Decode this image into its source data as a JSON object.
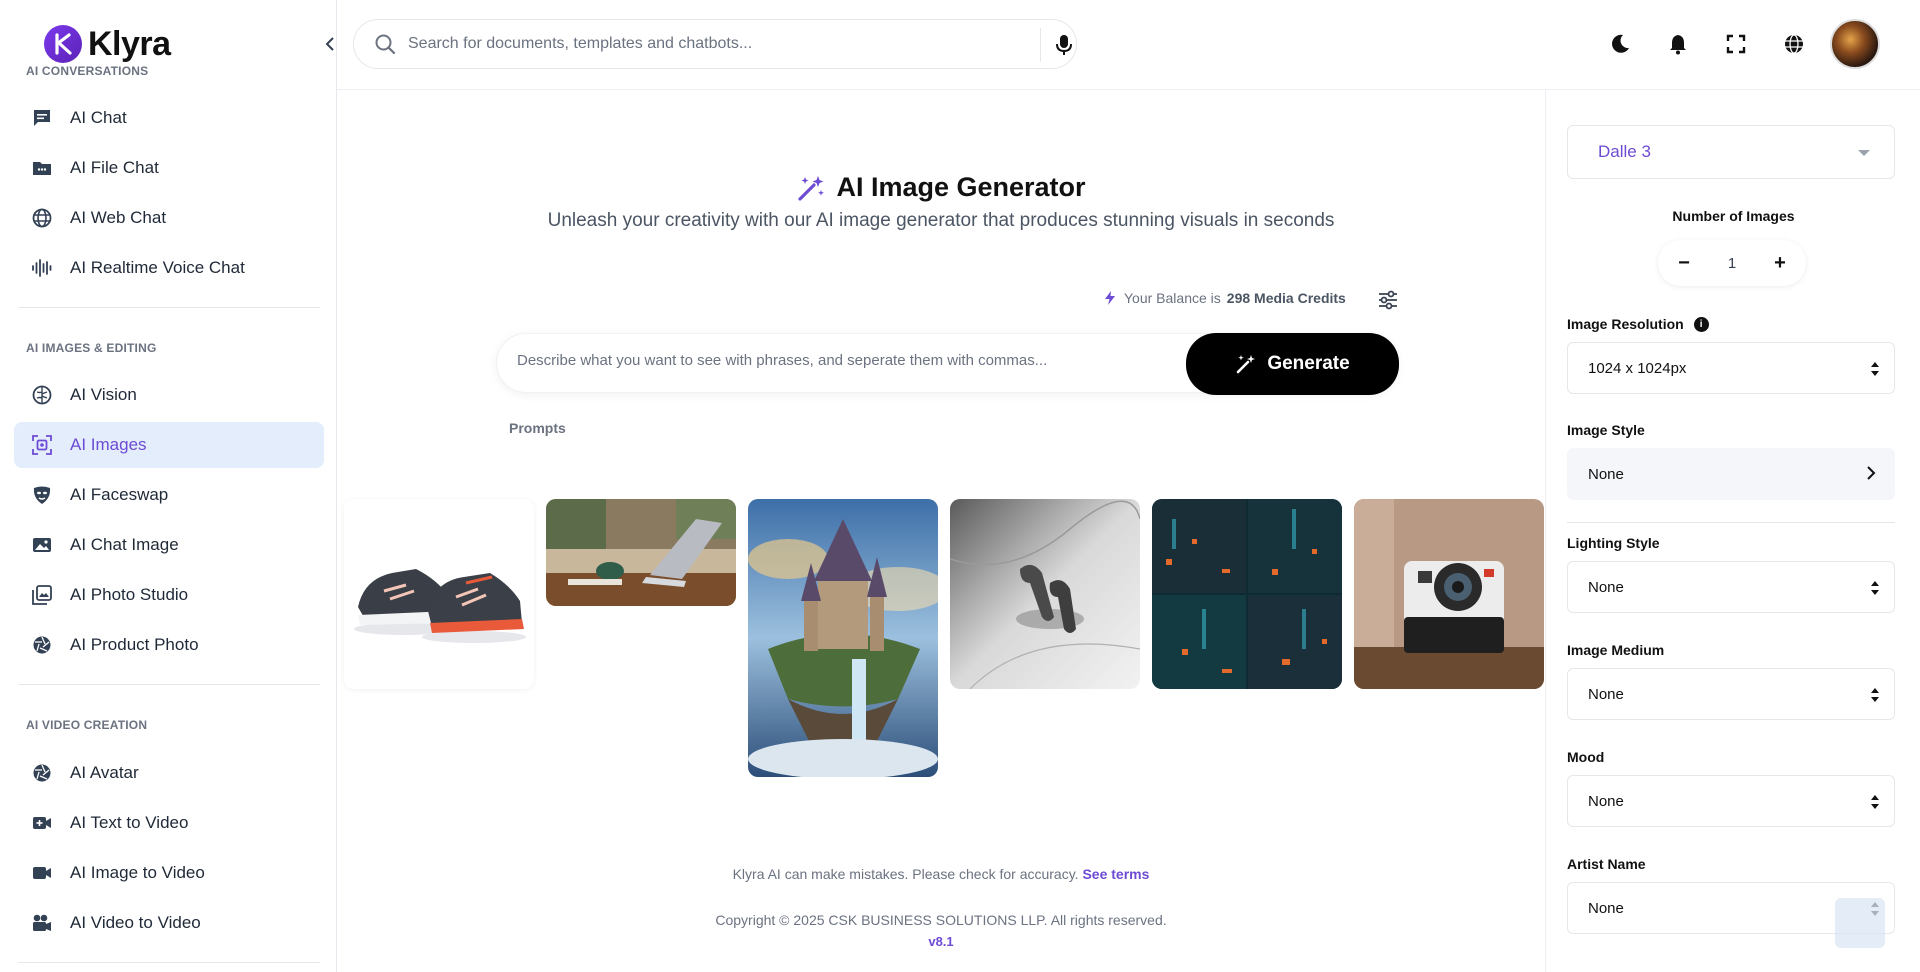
{
  "brand": {
    "name": "Klyra"
  },
  "sidebar": {
    "sections": [
      {
        "label": "AI CONVERSATIONS"
      },
      {
        "label": "AI IMAGES & EDITING"
      },
      {
        "label": "AI VIDEO CREATION"
      }
    ],
    "items": [
      {
        "label": "AI Chat",
        "icon": "chat-icon"
      },
      {
        "label": "AI File Chat",
        "icon": "folder-icon"
      },
      {
        "label": "AI Web Chat",
        "icon": "globe-icon"
      },
      {
        "label": "AI Realtime Voice Chat",
        "icon": "waveform-icon"
      },
      {
        "label": "AI Vision",
        "icon": "brain-icon"
      },
      {
        "label": "AI Images",
        "icon": "image-scan-icon",
        "active": true
      },
      {
        "label": "AI Faceswap",
        "icon": "mask-icon"
      },
      {
        "label": "AI Chat Image",
        "icon": "photo-icon"
      },
      {
        "label": "AI Photo Studio",
        "icon": "photo-library-icon"
      },
      {
        "label": "AI Product Photo",
        "icon": "aperture-icon"
      },
      {
        "label": "AI Avatar",
        "icon": "aperture-icon"
      },
      {
        "label": "AI Text to Video",
        "icon": "video-plus-icon"
      },
      {
        "label": "AI Image to Video",
        "icon": "video-camera-icon"
      },
      {
        "label": "AI Video to Video",
        "icon": "film-camera-icon"
      }
    ]
  },
  "topbar": {
    "search_placeholder": "Search for documents, templates and chatbots..."
  },
  "main": {
    "title": "AI Image Generator",
    "subtitle": "Unleash your creativity with our AI image generator that produces stunning visuals in seconds",
    "balance_prefix": "Your Balance is",
    "balance_value": "298 Media Credits",
    "prompt_placeholder": "Describe what you want to see with phrases, and seperate them with commas...",
    "generate_label": "Generate",
    "prompts_label": "Prompts",
    "examples": [
      {
        "name": "sneakers",
        "icon": "sneakers-image"
      },
      {
        "name": "laptop-desk",
        "icon": "laptop-image"
      },
      {
        "name": "floating-castle",
        "icon": "castle-image"
      },
      {
        "name": "earbuds",
        "icon": "earbuds-image"
      },
      {
        "name": "neon-city",
        "icon": "city-image"
      },
      {
        "name": "instant-camera",
        "icon": "camera-image"
      }
    ],
    "disclaimer": "Klyra AI can make mistakes. Please check for accuracy.",
    "terms_link": "See terms",
    "copyright": "Copyright © 2025 CSK BUSINESS SOLUTIONS LLP. All rights reserved.",
    "version": "v8.1"
  },
  "panel": {
    "model": "Dalle 3",
    "num_images_label": "Number of Images",
    "num_images_value": "1",
    "resolution_label": "Image Resolution",
    "resolution_value": "1024 x 1024px",
    "style_label": "Image Style",
    "style_value": "None",
    "lighting_label": "Lighting Style",
    "lighting_value": "None",
    "medium_label": "Image Medium",
    "medium_value": "None",
    "mood_label": "Mood",
    "mood_value": "None",
    "artist_label": "Artist Name",
    "artist_value": "None"
  },
  "colors": {
    "accent": "#6d4bd4",
    "active_bg": "#e3edfb",
    "generate_bg": "#000000"
  }
}
